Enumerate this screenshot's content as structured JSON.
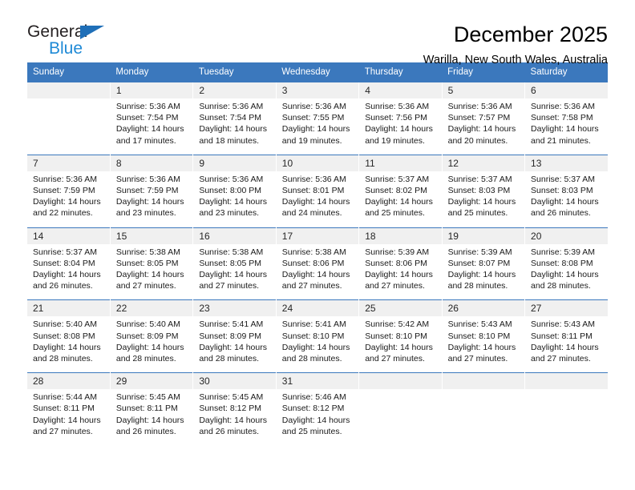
{
  "brand": {
    "name_part1": "General",
    "name_part2": "Blue",
    "triangle_color": "#1f6fb8",
    "blue_color": "#1f8ad6"
  },
  "header": {
    "title": "December 2025",
    "subtitle": "Warilla, New South Wales, Australia"
  },
  "theme": {
    "header_bg": "#3b78bd",
    "header_text": "#ffffff",
    "daynum_bg": "#f0f0f0",
    "cell_bg": "#ffffff"
  },
  "weekdays": [
    "Sunday",
    "Monday",
    "Tuesday",
    "Wednesday",
    "Thursday",
    "Friday",
    "Saturday"
  ],
  "weeks": [
    [
      {
        "day": "",
        "sunrise": "",
        "sunset": "",
        "daylight_line1": "",
        "daylight_line2": ""
      },
      {
        "day": "1",
        "sunrise": "Sunrise: 5:36 AM",
        "sunset": "Sunset: 7:54 PM",
        "daylight_line1": "Daylight: 14 hours",
        "daylight_line2": "and 17 minutes."
      },
      {
        "day": "2",
        "sunrise": "Sunrise: 5:36 AM",
        "sunset": "Sunset: 7:54 PM",
        "daylight_line1": "Daylight: 14 hours",
        "daylight_line2": "and 18 minutes."
      },
      {
        "day": "3",
        "sunrise": "Sunrise: 5:36 AM",
        "sunset": "Sunset: 7:55 PM",
        "daylight_line1": "Daylight: 14 hours",
        "daylight_line2": "and 19 minutes."
      },
      {
        "day": "4",
        "sunrise": "Sunrise: 5:36 AM",
        "sunset": "Sunset: 7:56 PM",
        "daylight_line1": "Daylight: 14 hours",
        "daylight_line2": "and 19 minutes."
      },
      {
        "day": "5",
        "sunrise": "Sunrise: 5:36 AM",
        "sunset": "Sunset: 7:57 PM",
        "daylight_line1": "Daylight: 14 hours",
        "daylight_line2": "and 20 minutes."
      },
      {
        "day": "6",
        "sunrise": "Sunrise: 5:36 AM",
        "sunset": "Sunset: 7:58 PM",
        "daylight_line1": "Daylight: 14 hours",
        "daylight_line2": "and 21 minutes."
      }
    ],
    [
      {
        "day": "7",
        "sunrise": "Sunrise: 5:36 AM",
        "sunset": "Sunset: 7:59 PM",
        "daylight_line1": "Daylight: 14 hours",
        "daylight_line2": "and 22 minutes."
      },
      {
        "day": "8",
        "sunrise": "Sunrise: 5:36 AM",
        "sunset": "Sunset: 7:59 PM",
        "daylight_line1": "Daylight: 14 hours",
        "daylight_line2": "and 23 minutes."
      },
      {
        "day": "9",
        "sunrise": "Sunrise: 5:36 AM",
        "sunset": "Sunset: 8:00 PM",
        "daylight_line1": "Daylight: 14 hours",
        "daylight_line2": "and 23 minutes."
      },
      {
        "day": "10",
        "sunrise": "Sunrise: 5:36 AM",
        "sunset": "Sunset: 8:01 PM",
        "daylight_line1": "Daylight: 14 hours",
        "daylight_line2": "and 24 minutes."
      },
      {
        "day": "11",
        "sunrise": "Sunrise: 5:37 AM",
        "sunset": "Sunset: 8:02 PM",
        "daylight_line1": "Daylight: 14 hours",
        "daylight_line2": "and 25 minutes."
      },
      {
        "day": "12",
        "sunrise": "Sunrise: 5:37 AM",
        "sunset": "Sunset: 8:03 PM",
        "daylight_line1": "Daylight: 14 hours",
        "daylight_line2": "and 25 minutes."
      },
      {
        "day": "13",
        "sunrise": "Sunrise: 5:37 AM",
        "sunset": "Sunset: 8:03 PM",
        "daylight_line1": "Daylight: 14 hours",
        "daylight_line2": "and 26 minutes."
      }
    ],
    [
      {
        "day": "14",
        "sunrise": "Sunrise: 5:37 AM",
        "sunset": "Sunset: 8:04 PM",
        "daylight_line1": "Daylight: 14 hours",
        "daylight_line2": "and 26 minutes."
      },
      {
        "day": "15",
        "sunrise": "Sunrise: 5:38 AM",
        "sunset": "Sunset: 8:05 PM",
        "daylight_line1": "Daylight: 14 hours",
        "daylight_line2": "and 27 minutes."
      },
      {
        "day": "16",
        "sunrise": "Sunrise: 5:38 AM",
        "sunset": "Sunset: 8:05 PM",
        "daylight_line1": "Daylight: 14 hours",
        "daylight_line2": "and 27 minutes."
      },
      {
        "day": "17",
        "sunrise": "Sunrise: 5:38 AM",
        "sunset": "Sunset: 8:06 PM",
        "daylight_line1": "Daylight: 14 hours",
        "daylight_line2": "and 27 minutes."
      },
      {
        "day": "18",
        "sunrise": "Sunrise: 5:39 AM",
        "sunset": "Sunset: 8:06 PM",
        "daylight_line1": "Daylight: 14 hours",
        "daylight_line2": "and 27 minutes."
      },
      {
        "day": "19",
        "sunrise": "Sunrise: 5:39 AM",
        "sunset": "Sunset: 8:07 PM",
        "daylight_line1": "Daylight: 14 hours",
        "daylight_line2": "and 28 minutes."
      },
      {
        "day": "20",
        "sunrise": "Sunrise: 5:39 AM",
        "sunset": "Sunset: 8:08 PM",
        "daylight_line1": "Daylight: 14 hours",
        "daylight_line2": "and 28 minutes."
      }
    ],
    [
      {
        "day": "21",
        "sunrise": "Sunrise: 5:40 AM",
        "sunset": "Sunset: 8:08 PM",
        "daylight_line1": "Daylight: 14 hours",
        "daylight_line2": "and 28 minutes."
      },
      {
        "day": "22",
        "sunrise": "Sunrise: 5:40 AM",
        "sunset": "Sunset: 8:09 PM",
        "daylight_line1": "Daylight: 14 hours",
        "daylight_line2": "and 28 minutes."
      },
      {
        "day": "23",
        "sunrise": "Sunrise: 5:41 AM",
        "sunset": "Sunset: 8:09 PM",
        "daylight_line1": "Daylight: 14 hours",
        "daylight_line2": "and 28 minutes."
      },
      {
        "day": "24",
        "sunrise": "Sunrise: 5:41 AM",
        "sunset": "Sunset: 8:10 PM",
        "daylight_line1": "Daylight: 14 hours",
        "daylight_line2": "and 28 minutes."
      },
      {
        "day": "25",
        "sunrise": "Sunrise: 5:42 AM",
        "sunset": "Sunset: 8:10 PM",
        "daylight_line1": "Daylight: 14 hours",
        "daylight_line2": "and 27 minutes."
      },
      {
        "day": "26",
        "sunrise": "Sunrise: 5:43 AM",
        "sunset": "Sunset: 8:10 PM",
        "daylight_line1": "Daylight: 14 hours",
        "daylight_line2": "and 27 minutes."
      },
      {
        "day": "27",
        "sunrise": "Sunrise: 5:43 AM",
        "sunset": "Sunset: 8:11 PM",
        "daylight_line1": "Daylight: 14 hours",
        "daylight_line2": "and 27 minutes."
      }
    ],
    [
      {
        "day": "28",
        "sunrise": "Sunrise: 5:44 AM",
        "sunset": "Sunset: 8:11 PM",
        "daylight_line1": "Daylight: 14 hours",
        "daylight_line2": "and 27 minutes."
      },
      {
        "day": "29",
        "sunrise": "Sunrise: 5:45 AM",
        "sunset": "Sunset: 8:11 PM",
        "daylight_line1": "Daylight: 14 hours",
        "daylight_line2": "and 26 minutes."
      },
      {
        "day": "30",
        "sunrise": "Sunrise: 5:45 AM",
        "sunset": "Sunset: 8:12 PM",
        "daylight_line1": "Daylight: 14 hours",
        "daylight_line2": "and 26 minutes."
      },
      {
        "day": "31",
        "sunrise": "Sunrise: 5:46 AM",
        "sunset": "Sunset: 8:12 PM",
        "daylight_line1": "Daylight: 14 hours",
        "daylight_line2": "and 25 minutes."
      },
      {
        "day": "",
        "sunrise": "",
        "sunset": "",
        "daylight_line1": "",
        "daylight_line2": ""
      },
      {
        "day": "",
        "sunrise": "",
        "sunset": "",
        "daylight_line1": "",
        "daylight_line2": ""
      },
      {
        "day": "",
        "sunrise": "",
        "sunset": "",
        "daylight_line1": "",
        "daylight_line2": ""
      }
    ]
  ]
}
